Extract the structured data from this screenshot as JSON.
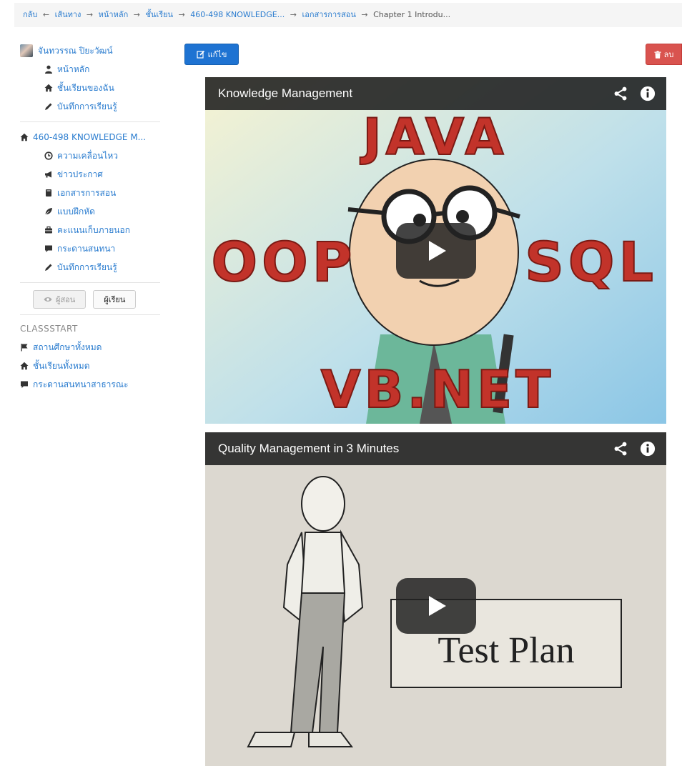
{
  "breadcrumb": {
    "items": [
      "กลับ",
      "เส้นทาง",
      "หน้าหลัก",
      "ชั้นเรียน",
      "460-498 KNOWLEDGE...",
      "เอกสารการสอน"
    ],
    "back_arrow": "←",
    "arrow": "→",
    "current": "Chapter 1 Introdu..."
  },
  "sidebar": {
    "user_name": "จันทวรรณ ปิยะวัฒน์",
    "user_menu": [
      {
        "label": "หน้าหลัก",
        "icon": "user-icon"
      },
      {
        "label": "ชั้นเรียนของฉัน",
        "icon": "home-icon"
      },
      {
        "label": "บันทึกการเรียนรู้",
        "icon": "pencil-icon"
      }
    ],
    "course_name": "460-498 KNOWLEDGE M...",
    "course_menu": [
      {
        "label": "ความเคลื่อนไหว",
        "icon": "clock-icon"
      },
      {
        "label": "ข่าวประกาศ",
        "icon": "megaphone-icon"
      },
      {
        "label": "เอกสารการสอน",
        "icon": "book-icon"
      },
      {
        "label": "แบบฝึกหัด",
        "icon": "leaf-icon"
      },
      {
        "label": "คะแนนเก็บภายนอก",
        "icon": "briefcase-icon"
      },
      {
        "label": "กระดานสนทนา",
        "icon": "comment-icon"
      },
      {
        "label": "บันทึกการเรียนรู้",
        "icon": "pencil-icon"
      }
    ],
    "role_teacher": "ผู้สอน",
    "role_student": "ผู้เรียน",
    "section_title": "CLASSSTART",
    "classstart_menu": [
      {
        "label": "สถานศึกษาทั้งหมด",
        "icon": "flag-icon"
      },
      {
        "label": "ชั้นเรียนทั้งหมด",
        "icon": "home-icon"
      },
      {
        "label": "กระดานสนทนาสาธารณะ",
        "icon": "comment-icon"
      }
    ]
  },
  "toolbar": {
    "edit_label": "แก้ไข",
    "delete_label": "ลบ"
  },
  "videos": [
    {
      "title": "Knowledge Management",
      "thumb_words": [
        "JAVA",
        "OOP",
        "SQL",
        "VB.NET"
      ]
    },
    {
      "title": "Quality Management in 3 Minutes",
      "thumb_words": [
        "Test Plan"
      ]
    }
  ],
  "colors": {
    "link": "#2a7ccf",
    "edit_button": "#1e73d2",
    "delete_button": "#d9534f"
  }
}
